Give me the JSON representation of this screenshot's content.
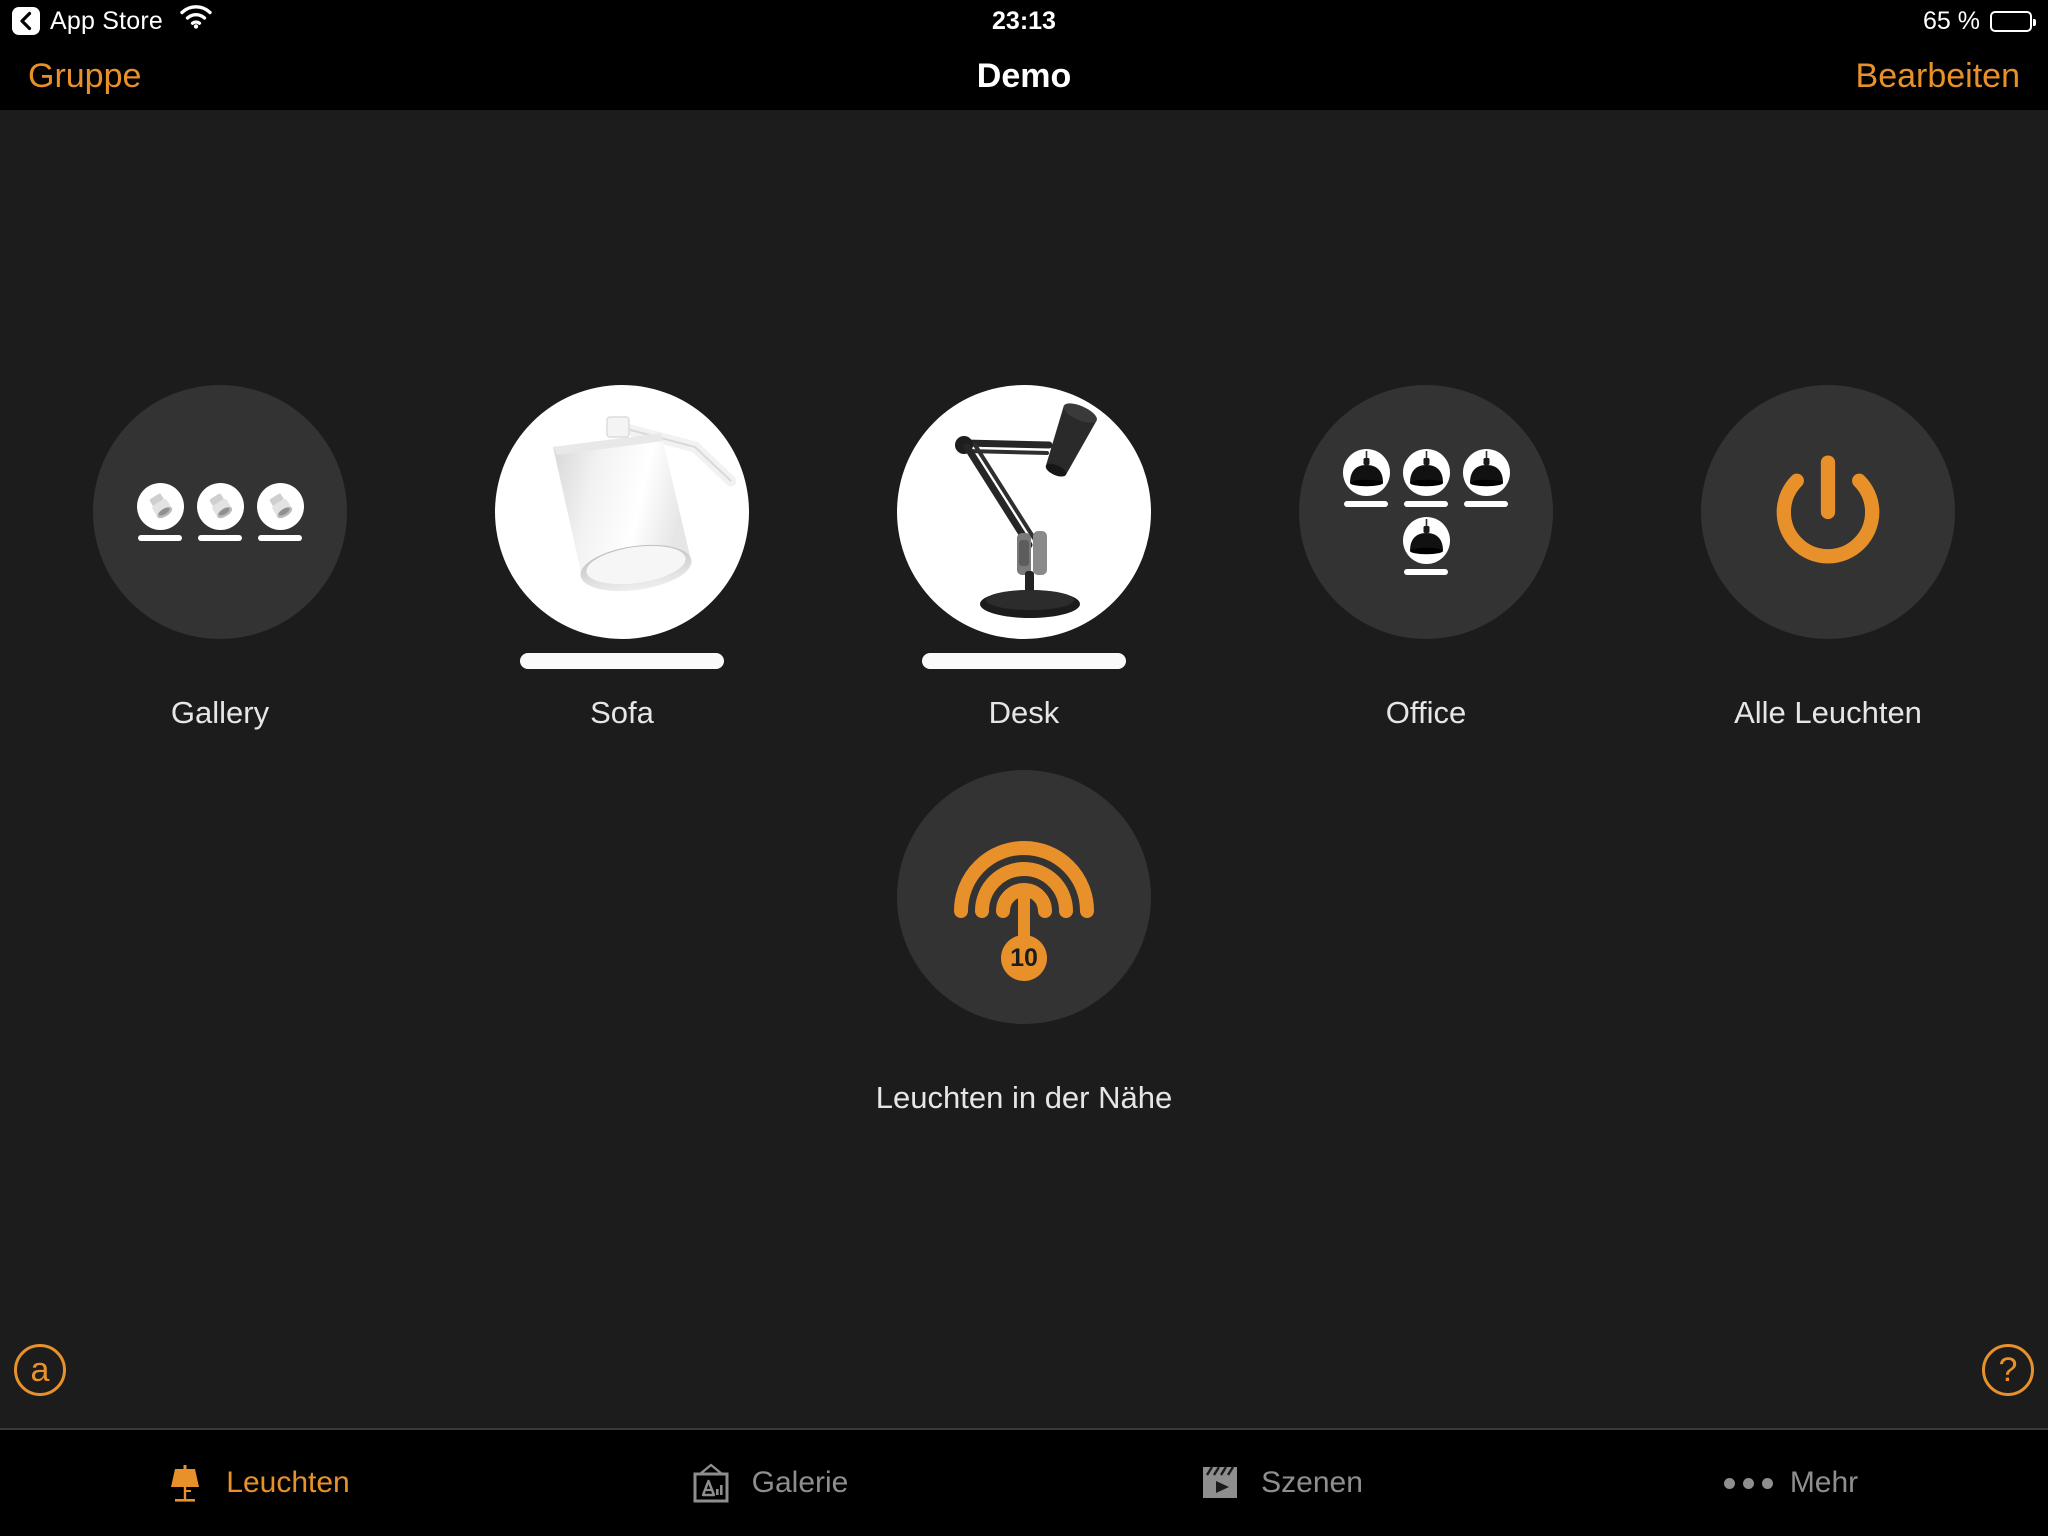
{
  "status_bar": {
    "back_label": "App Store",
    "back_icon": "chevron-left-icon",
    "wifi_icon": "wifi-icon",
    "time": "23:13",
    "battery_percent": "65 %",
    "battery_level": 65,
    "battery_icon": "battery-icon"
  },
  "nav_bar": {
    "left_button": "Gruppe",
    "title": "Demo",
    "right_button": "Bearbeiten"
  },
  "colors": {
    "accent": "#E8912A",
    "background": "#1c1c1c",
    "bar_background": "#000000",
    "bubble": "#333333",
    "inactive_tab": "#8e8e8e"
  },
  "main": {
    "tiles": [
      {
        "label": "Gallery",
        "type": "group",
        "icon": "spotlight-group-icon",
        "count": 3,
        "state": "on"
      },
      {
        "label": "Sofa",
        "type": "light",
        "icon": "pendant-shade-lamp-photo",
        "state": "on"
      },
      {
        "label": "Desk",
        "type": "light",
        "icon": "anglepoise-desk-lamp-photo",
        "state": "on"
      },
      {
        "label": "Office",
        "type": "group",
        "icon": "pendant-group-icon",
        "count": 4,
        "state": "on"
      },
      {
        "label": "Alle Leuchten",
        "type": "action",
        "icon": "power-icon"
      }
    ],
    "nearby": {
      "label": "Leuchten in der Nähe",
      "icon": "broadcast-antenna-icon",
      "badge": "10"
    }
  },
  "corner_buttons": {
    "left": {
      "label": "a",
      "icon": "circled-a-icon"
    },
    "right": {
      "label": "?",
      "icon": "circled-question-icon"
    }
  },
  "tab_bar": {
    "items": [
      {
        "label": "Leuchten",
        "icon": "table-lamp-icon",
        "active": true
      },
      {
        "label": "Galerie",
        "icon": "picture-frame-icon",
        "active": false
      },
      {
        "label": "Szenen",
        "icon": "clapperboard-icon",
        "active": false
      },
      {
        "label": "Mehr",
        "icon": "ellipsis-icon",
        "active": false
      }
    ]
  }
}
